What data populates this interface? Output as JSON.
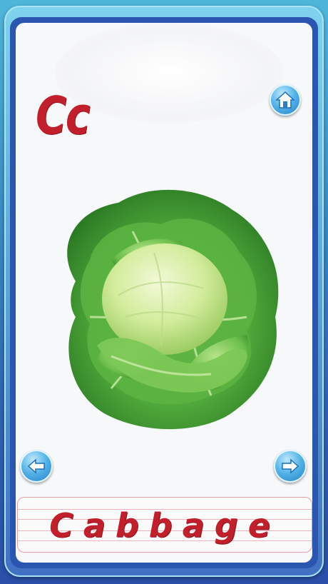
{
  "card": {
    "letter": "Cc",
    "word": "Cabbage"
  },
  "nav": {
    "home_icon": "home-icon",
    "prev_icon": "arrow-left-icon",
    "next_icon": "arrow-right-icon"
  },
  "colors": {
    "letter_red": "#c21f2c",
    "frame_blue": "#2a56b0",
    "button_blue": "#54b3e8"
  }
}
